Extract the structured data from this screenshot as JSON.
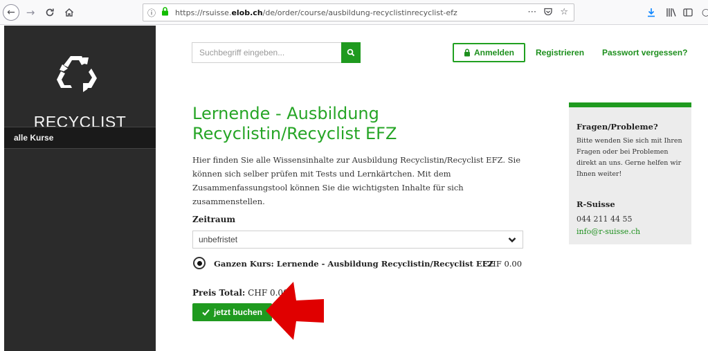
{
  "browser": {
    "url_prefix": "https://rsuisse.",
    "url_domain": "elob.ch",
    "url_path": "/de/order/course/ausbildung-recyclistinrecyclist-efz"
  },
  "sidebar": {
    "logo_text": "RECYCLIST",
    "items": [
      {
        "label": "alle Kurse"
      }
    ]
  },
  "header": {
    "search_placeholder": "Suchbegriff eingeben...",
    "login_label": "Anmelden",
    "register_label": "Registrieren",
    "forgot_label": "Passwort vergessen?"
  },
  "main": {
    "title": "Lernende - Ausbildung Recyclistin/Recyclist EFZ",
    "intro": "Hier finden Sie alle Wissensinhalte zur Ausbildung Recyclistin/Recyclist EFZ. Sie können sich selber prüfen mit Tests und Lernkärtchen. Mit dem Zusammenfassungstool können Sie die wichtigsten Inhalte für sich zusammenstellen.",
    "period_label": "Zeitraum",
    "period_value": "unbefristet",
    "option_label": "Ganzen Kurs: Lernende - Ausbildung Recyclistin/Recyclist EFZ",
    "option_price": "CHF 0.00",
    "total_label": "Preis Total:",
    "total_value": "CHF 0.00",
    "book_label": "jetzt buchen"
  },
  "help": {
    "title": "Fragen/Probleme?",
    "text": "Bitte wenden Sie sich mit Ihren Fragen oder bei Problemen direkt an uns. Gerne helfen wir Ihnen weiter!",
    "company": "R-Suisse",
    "phone": "044 211 44 55",
    "email": "info@r-suisse.ch"
  },
  "colors": {
    "brand_green": "#1f9a1f",
    "sidebar_bg": "#2b2b2b",
    "annotation_red": "#e00000"
  }
}
